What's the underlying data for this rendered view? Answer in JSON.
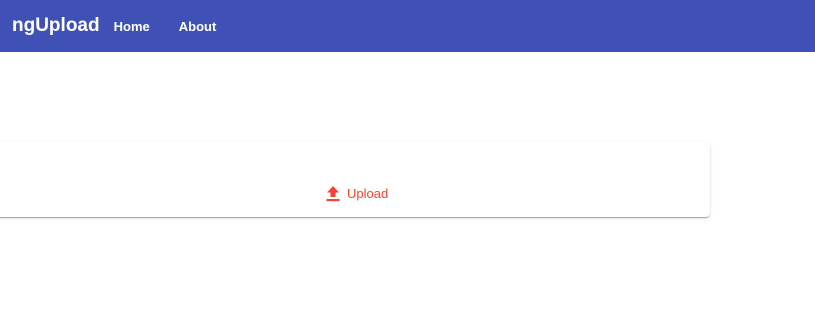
{
  "toolbar": {
    "brand": "ngUpload",
    "nav": {
      "home_label": "Home",
      "about_label": "About"
    },
    "color": "#3f51b5"
  },
  "card": {
    "upload_button": {
      "label": "Upload",
      "icon": "upload-icon",
      "color": "#f44336"
    }
  }
}
